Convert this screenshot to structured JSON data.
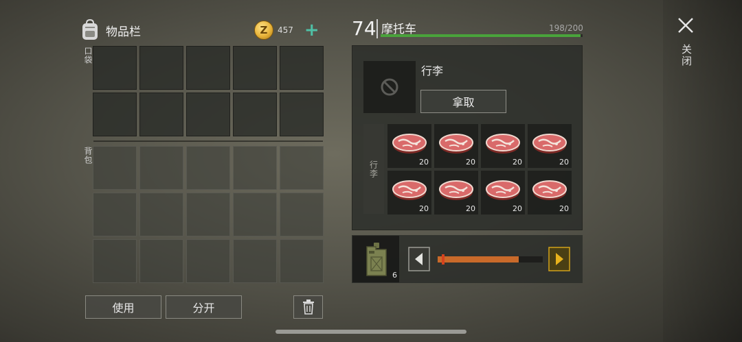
{
  "inventory": {
    "title": "物品栏",
    "pocket_label": "口袋",
    "backpack_label": "背包",
    "pocket_slots": 10,
    "backpack_slots": 15
  },
  "currency": {
    "symbol": "Z",
    "amount": "457",
    "add": "+"
  },
  "actions": {
    "use_label": "使用",
    "split_label": "分开"
  },
  "vehicle": {
    "level": "74",
    "name": "摩托车",
    "hp_text": "198/200",
    "hp_fraction": 0.99,
    "hp_color": "#49a33b"
  },
  "storage": {
    "title": "行李",
    "take_label": "拿取",
    "side_label": "行李",
    "items": [
      {
        "icon": "steak-icon",
        "qty": "20"
      },
      {
        "icon": "steak-icon",
        "qty": "20"
      },
      {
        "icon": "steak-icon",
        "qty": "20"
      },
      {
        "icon": "steak-icon",
        "qty": "20"
      },
      {
        "icon": "steak-icon",
        "qty": "20"
      },
      {
        "icon": "steak-icon",
        "qty": "20"
      },
      {
        "icon": "steak-icon",
        "qty": "20"
      },
      {
        "icon": "steak-icon",
        "qty": "20"
      }
    ]
  },
  "fuel": {
    "icon": "fuel-canister-icon",
    "qty": "6",
    "slider_fraction": 0.77,
    "slider_color": "#c96a2a"
  },
  "close": {
    "label": "关闭"
  }
}
